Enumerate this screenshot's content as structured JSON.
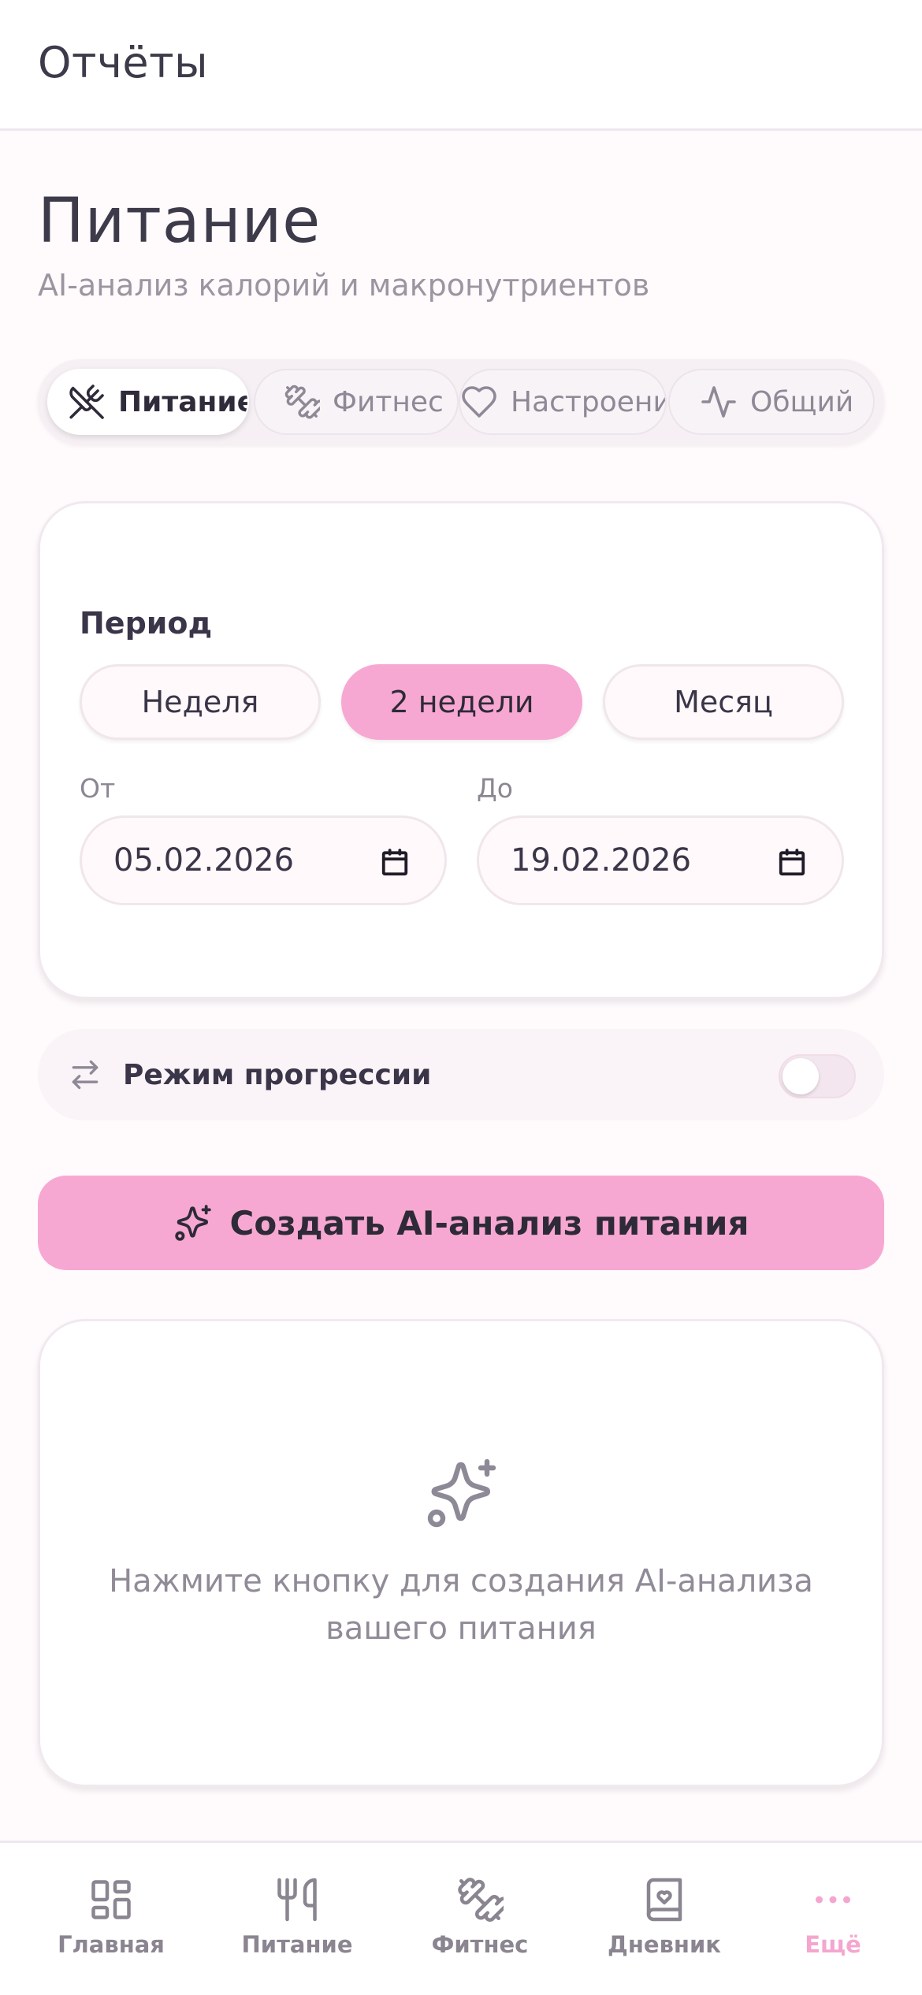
{
  "header": {
    "title": "Отчёты"
  },
  "page": {
    "title": "Питание",
    "subtitle": "AI-анализ калорий и макронутриентов"
  },
  "tabs": [
    {
      "label": "Питание",
      "icon": "utensils-crossed-icon",
      "active": true
    },
    {
      "label": "Фитнес",
      "icon": "dumbbell-icon",
      "active": false
    },
    {
      "label": "Настроение",
      "icon": "heart-icon",
      "active": false
    },
    {
      "label": "Общий",
      "icon": "activity-icon",
      "active": false
    }
  ],
  "period": {
    "label": "Период",
    "options": [
      {
        "label": "Неделя",
        "active": false
      },
      {
        "label": "2 недели",
        "active": true
      },
      {
        "label": "Месяц",
        "active": false
      }
    ],
    "from_label": "От",
    "from_value": "05.02.2026",
    "to_label": "До",
    "to_value": "19.02.2026"
  },
  "progression": {
    "label": "Режим прогрессии",
    "enabled": false
  },
  "cta": {
    "label": "Создать AI-анализ питания",
    "icon": "sparkles-icon"
  },
  "empty_state": {
    "icon": "sparkles-icon",
    "text_line1": "Нажмите кнопку для создания AI-анализа",
    "text_line2": "вашего питания"
  },
  "bottom_nav": [
    {
      "label": "Главная",
      "icon": "dashboard-icon",
      "active": false
    },
    {
      "label": "Питание",
      "icon": "utensils-icon",
      "active": false
    },
    {
      "label": "Фитнес",
      "icon": "dumbbell-icon",
      "active": false
    },
    {
      "label": "Дневник",
      "icon": "journal-icon",
      "active": false
    },
    {
      "label": "Ещё",
      "icon": "more-dots-icon",
      "active": true
    }
  ],
  "colors": {
    "accent": "#f7a8d2",
    "background": "#fffafc",
    "text": "#3a3548",
    "muted": "#9a95a0"
  }
}
